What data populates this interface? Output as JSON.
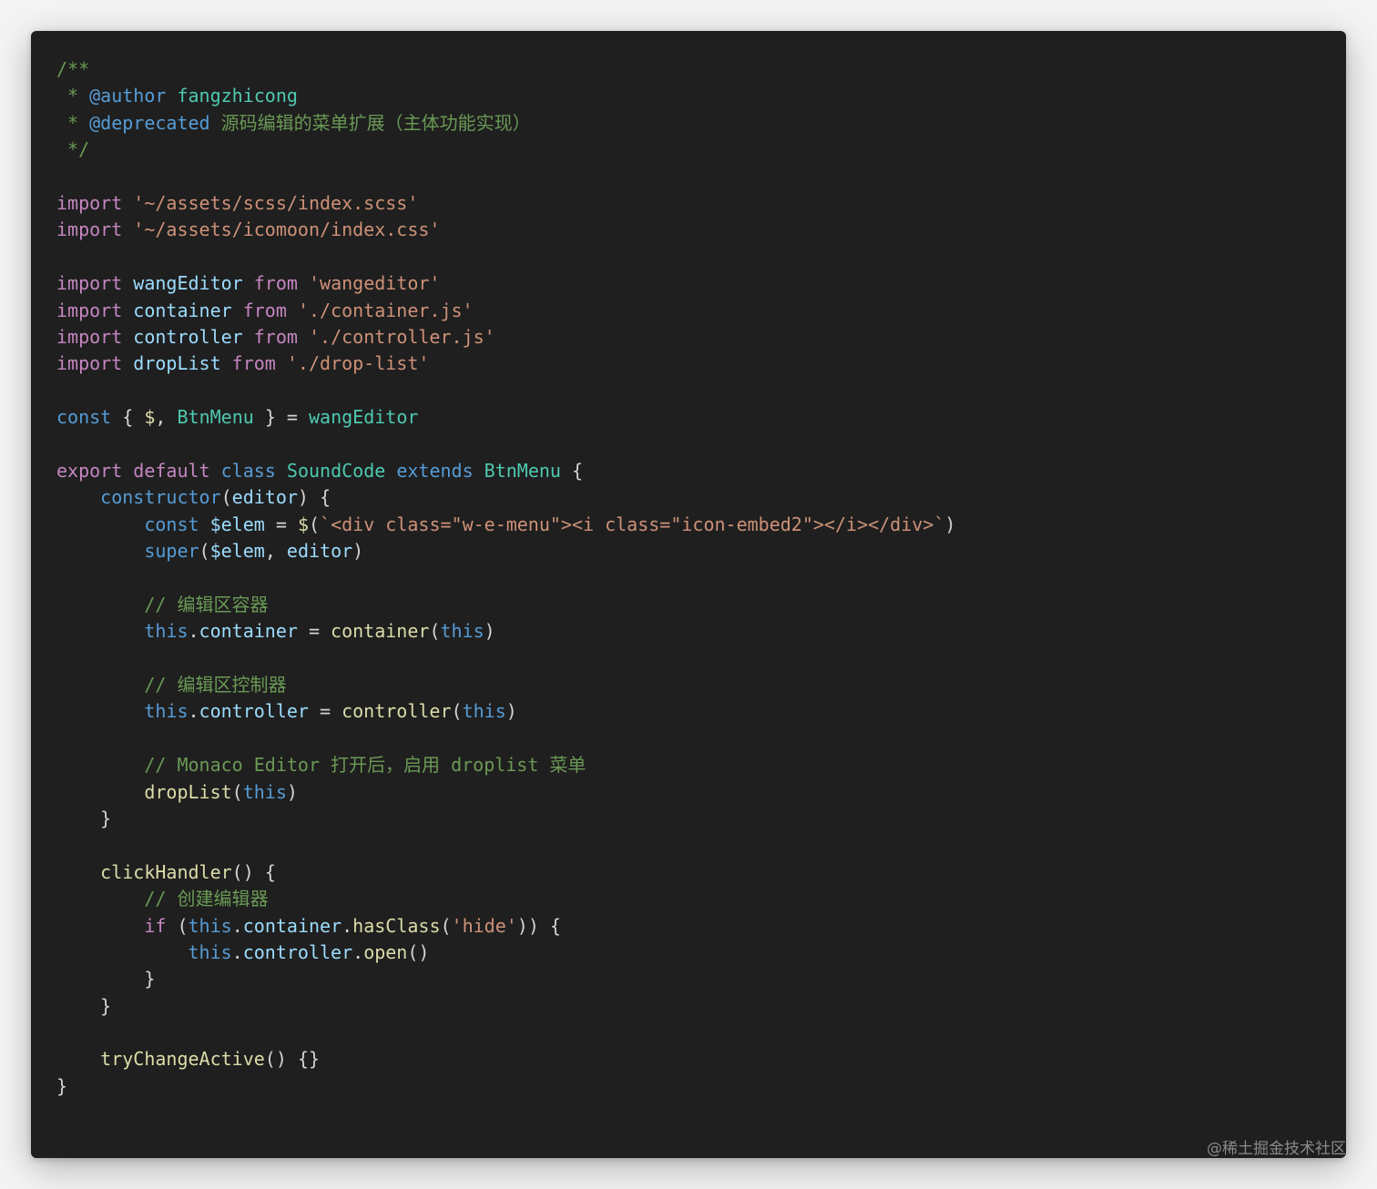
{
  "colors": {
    "background": "#1f1f1f",
    "default": "#d4d4d4",
    "comment": "#6a9955",
    "keyword": "#c586c0",
    "storage": "#569cd6",
    "string": "#ce9178",
    "variable": "#9cdcfe",
    "type": "#4ec9b0",
    "function": "#dcdcaa"
  },
  "code_lines": [
    [
      [
        "/**",
        "comment"
      ]
    ],
    [
      [
        " * ",
        "comment"
      ],
      [
        "@author",
        "storage"
      ],
      [
        " fangzhicong",
        "type"
      ]
    ],
    [
      [
        " * ",
        "comment"
      ],
      [
        "@deprecated",
        "storage"
      ],
      [
        " 源码编辑的菜单扩展（主体功能实现）",
        "comment"
      ]
    ],
    [
      [
        " */",
        "comment"
      ]
    ],
    [],
    [
      [
        "import",
        "keyword"
      ],
      [
        " ",
        "default"
      ],
      [
        "'~/assets/scss/index.scss'",
        "string"
      ]
    ],
    [
      [
        "import",
        "keyword"
      ],
      [
        " ",
        "default"
      ],
      [
        "'~/assets/icomoon/index.css'",
        "string"
      ]
    ],
    [],
    [
      [
        "import",
        "keyword"
      ],
      [
        " ",
        "default"
      ],
      [
        "wangEditor",
        "variable"
      ],
      [
        " ",
        "default"
      ],
      [
        "from",
        "keyword"
      ],
      [
        " ",
        "default"
      ],
      [
        "'wangeditor'",
        "string"
      ]
    ],
    [
      [
        "import",
        "keyword"
      ],
      [
        " ",
        "default"
      ],
      [
        "container",
        "variable"
      ],
      [
        " ",
        "default"
      ],
      [
        "from",
        "keyword"
      ],
      [
        " ",
        "default"
      ],
      [
        "'./container.js'",
        "string"
      ]
    ],
    [
      [
        "import",
        "keyword"
      ],
      [
        " ",
        "default"
      ],
      [
        "controller",
        "variable"
      ],
      [
        " ",
        "default"
      ],
      [
        "from",
        "keyword"
      ],
      [
        " ",
        "default"
      ],
      [
        "'./controller.js'",
        "string"
      ]
    ],
    [
      [
        "import",
        "keyword"
      ],
      [
        " ",
        "default"
      ],
      [
        "dropList",
        "variable"
      ],
      [
        " ",
        "default"
      ],
      [
        "from",
        "keyword"
      ],
      [
        " ",
        "default"
      ],
      [
        "'./drop-list'",
        "string"
      ]
    ],
    [],
    [
      [
        "const",
        "storage"
      ],
      [
        " { ",
        "default"
      ],
      [
        "$",
        "function"
      ],
      [
        ", ",
        "default"
      ],
      [
        "BtnMenu",
        "type"
      ],
      [
        " } = ",
        "default"
      ],
      [
        "wangEditor",
        "type"
      ]
    ],
    [],
    [
      [
        "export",
        "keyword"
      ],
      [
        " ",
        "default"
      ],
      [
        "default",
        "keyword"
      ],
      [
        " ",
        "default"
      ],
      [
        "class",
        "storage"
      ],
      [
        " ",
        "default"
      ],
      [
        "SoundCode",
        "type"
      ],
      [
        " ",
        "default"
      ],
      [
        "extends",
        "storage"
      ],
      [
        " ",
        "default"
      ],
      [
        "BtnMenu",
        "type"
      ],
      [
        " {",
        "default"
      ]
    ],
    [
      [
        "    ",
        "default"
      ],
      [
        "constructor",
        "storage"
      ],
      [
        "(",
        "default"
      ],
      [
        "editor",
        "variable"
      ],
      [
        ") {",
        "default"
      ]
    ],
    [
      [
        "        ",
        "default"
      ],
      [
        "const",
        "storage"
      ],
      [
        " ",
        "default"
      ],
      [
        "$elem",
        "variable"
      ],
      [
        " = ",
        "default"
      ],
      [
        "$",
        "function"
      ],
      [
        "(",
        "default"
      ],
      [
        "`<div class=\"w-e-menu\"><i class=\"icon-embed2\"></i></div>`",
        "string"
      ],
      [
        ")",
        "default"
      ]
    ],
    [
      [
        "        ",
        "default"
      ],
      [
        "super",
        "storage"
      ],
      [
        "(",
        "default"
      ],
      [
        "$elem",
        "variable"
      ],
      [
        ", ",
        "default"
      ],
      [
        "editor",
        "variable"
      ],
      [
        ")",
        "default"
      ]
    ],
    [],
    [
      [
        "        ",
        "default"
      ],
      [
        "// 编辑区容器",
        "comment"
      ]
    ],
    [
      [
        "        ",
        "default"
      ],
      [
        "this",
        "storage"
      ],
      [
        ".",
        "default"
      ],
      [
        "container",
        "variable"
      ],
      [
        " = ",
        "default"
      ],
      [
        "container",
        "function"
      ],
      [
        "(",
        "default"
      ],
      [
        "this",
        "storage"
      ],
      [
        ")",
        "default"
      ]
    ],
    [],
    [
      [
        "        ",
        "default"
      ],
      [
        "// 编辑区控制器",
        "comment"
      ]
    ],
    [
      [
        "        ",
        "default"
      ],
      [
        "this",
        "storage"
      ],
      [
        ".",
        "default"
      ],
      [
        "controller",
        "variable"
      ],
      [
        " = ",
        "default"
      ],
      [
        "controller",
        "function"
      ],
      [
        "(",
        "default"
      ],
      [
        "this",
        "storage"
      ],
      [
        ")",
        "default"
      ]
    ],
    [],
    [
      [
        "        ",
        "default"
      ],
      [
        "// Monaco Editor 打开后，启用 droplist 菜单",
        "comment"
      ]
    ],
    [
      [
        "        ",
        "default"
      ],
      [
        "dropList",
        "function"
      ],
      [
        "(",
        "default"
      ],
      [
        "this",
        "storage"
      ],
      [
        ")",
        "default"
      ]
    ],
    [
      [
        "    }",
        "default"
      ]
    ],
    [],
    [
      [
        "    ",
        "default"
      ],
      [
        "clickHandler",
        "function"
      ],
      [
        "() {",
        "default"
      ]
    ],
    [
      [
        "        ",
        "default"
      ],
      [
        "// 创建编辑器",
        "comment"
      ]
    ],
    [
      [
        "        ",
        "default"
      ],
      [
        "if",
        "keyword"
      ],
      [
        " (",
        "default"
      ],
      [
        "this",
        "storage"
      ],
      [
        ".",
        "default"
      ],
      [
        "container",
        "variable"
      ],
      [
        ".",
        "default"
      ],
      [
        "hasClass",
        "function"
      ],
      [
        "(",
        "default"
      ],
      [
        "'hide'",
        "string"
      ],
      [
        ")) {",
        "default"
      ]
    ],
    [
      [
        "            ",
        "default"
      ],
      [
        "this",
        "storage"
      ],
      [
        ".",
        "default"
      ],
      [
        "controller",
        "variable"
      ],
      [
        ".",
        "default"
      ],
      [
        "open",
        "function"
      ],
      [
        "()",
        "default"
      ]
    ],
    [
      [
        "        }",
        "default"
      ]
    ],
    [
      [
        "    }",
        "default"
      ]
    ],
    [],
    [
      [
        "    ",
        "default"
      ],
      [
        "tryChangeActive",
        "function"
      ],
      [
        "() {}",
        "default"
      ]
    ],
    [
      [
        "}",
        "default"
      ]
    ]
  ],
  "watermark": "@稀土掘金技术社区"
}
